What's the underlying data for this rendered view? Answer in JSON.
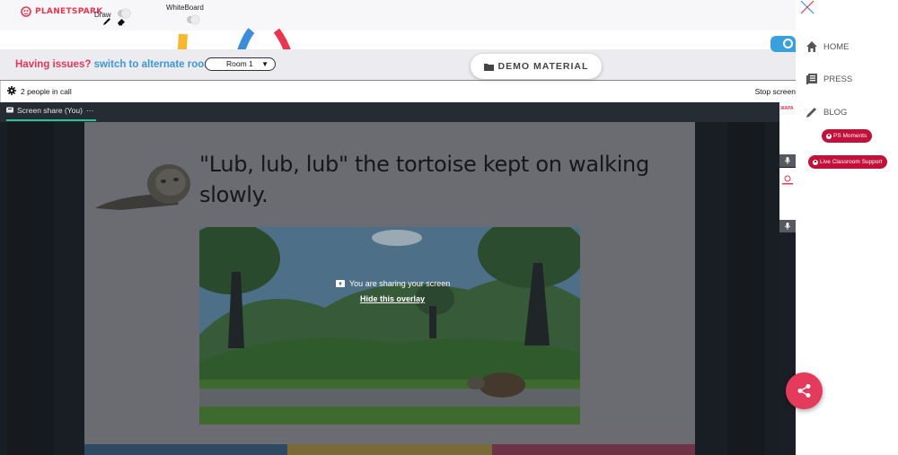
{
  "brand": {
    "name": "PLANETSPARK"
  },
  "toolbar": {
    "draw_label": "Draw",
    "whiteboard_label": "WhiteBoard"
  },
  "issue_bar": {
    "issue_text": "Having issues?",
    "switch_text": "switch to alternate room",
    "room_value": "Room 1",
    "demo_label": "DEMO MATERIAL"
  },
  "meeting": {
    "people_count": "2 people in call",
    "stop_screen": "Stop screen",
    "tab_label": "Screen share (You)",
    "tab_more": "···",
    "slide_title": "\"Lub, lub, lub\" the tortoise kept on walking slowly.",
    "overlay_message": "You are sharing your screen",
    "overlay_hide": "Hide this overlay",
    "thumb_logo": "ЖАРА"
  },
  "nav": {
    "items": [
      {
        "label": "HOME",
        "icon": "home-icon"
      },
      {
        "label": "PRESS",
        "icon": "press-icon"
      },
      {
        "label": "BLOG",
        "icon": "pencil-icon"
      }
    ],
    "ps_moments": "PS Moments",
    "live_support": "Live Classroom Support"
  },
  "colors": {
    "brand_red": "#e8364e",
    "link_blue": "#3b97d3",
    "pill_red": "#c3103a",
    "fab_red": "#e43a5c",
    "active_tab": "#27c39a"
  }
}
